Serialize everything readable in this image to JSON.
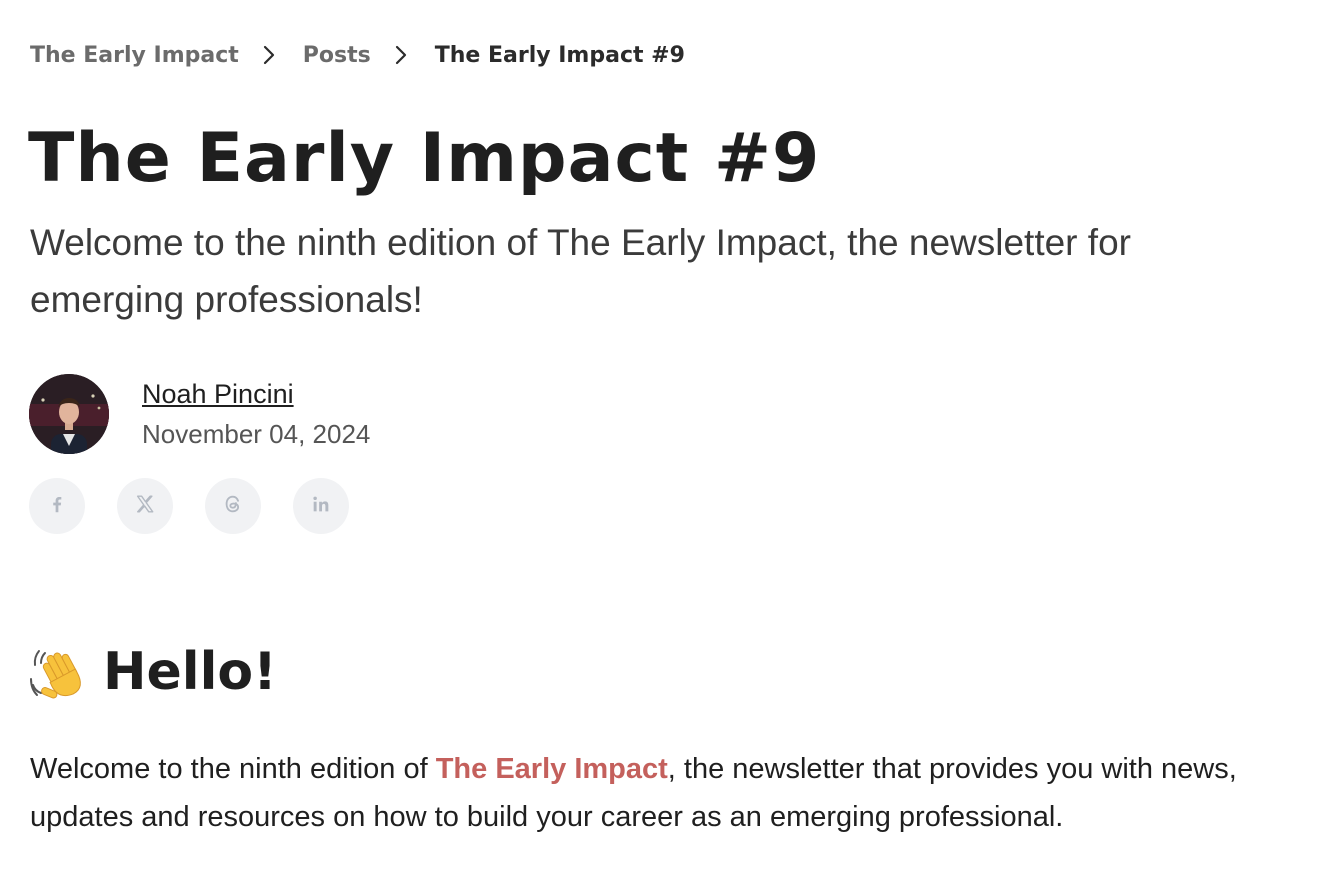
{
  "breadcrumb": {
    "items": [
      {
        "label": "The Early Impact"
      },
      {
        "label": "Posts"
      },
      {
        "label": "The Early Impact #9"
      }
    ]
  },
  "post": {
    "title": "The Early Impact #9",
    "subtitle": "Welcome to the ninth edition of The Early Impact, the newsletter for emerging professionals!",
    "author": {
      "name": "Noah Pincini",
      "date": "November 04, 2024"
    },
    "share": [
      {
        "icon": "facebook-icon"
      },
      {
        "icon": "x-twitter-icon"
      },
      {
        "icon": "threads-icon"
      },
      {
        "icon": "linkedin-icon"
      }
    ],
    "section_heading": {
      "emoji_icon": "waving-hand-icon",
      "text": "Hello!"
    },
    "body": {
      "before": "Welcome to the ninth edition of ",
      "link": "The Early Impact",
      "after": ", the newsletter that provides you with news, updates and resources on how to build your career as an emerging professional."
    }
  },
  "colors": {
    "text": "#1f1f1f",
    "muted": "#6b6b6b",
    "link_accent": "#c4605c",
    "icon_bg": "#f1f2f4",
    "icon_fg": "#b3b9c2"
  }
}
